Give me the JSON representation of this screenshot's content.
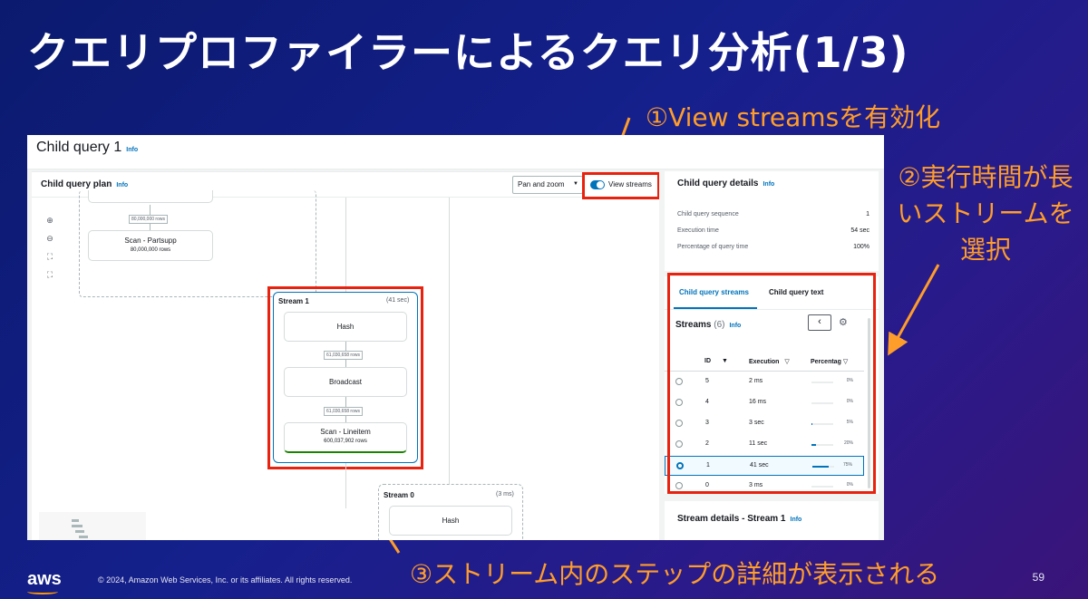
{
  "slide": {
    "title": "クエリプロファイラーによるクエリ分析(1/3)",
    "callout1": "①View streamsを有効化",
    "callout2": "②実行時間が長いストリームを選択",
    "callout3": "③ストリーム内のステップの詳細が表示される",
    "copyright": "© 2024, Amazon Web Services, Inc. or its affiliates. All rights reserved.",
    "page_number": "59",
    "logo": "aws",
    "accent_color": "#ff9d2a"
  },
  "console": {
    "title": "Child query 1",
    "info": "Info",
    "plan": {
      "title": "Child query plan",
      "info": "Info",
      "pan_zoom_label": "Pan and zoom",
      "view_streams_label": "View streams",
      "view_streams_enabled": true,
      "upper_group": {
        "rows_top": "80,000,000 rows",
        "scan_node": "Scan - Partsupp",
        "scan_rows": "80,000,000 rows"
      },
      "stream1": {
        "title": "Stream 1",
        "time": "(41 sec)",
        "node_hash": "Hash",
        "rows_a": "61,030,658 rows",
        "node_broadcast": "Broadcast",
        "rows_b": "61,030,658 rows",
        "node_scan": "Scan - Lineitem",
        "scan_rows": "600,037,902 rows"
      },
      "stream0": {
        "title": "Stream 0",
        "time": "(3 ms)",
        "node_hash": "Hash"
      }
    },
    "details": {
      "title": "Child query details",
      "info": "Info",
      "rows": [
        {
          "label": "Child query sequence",
          "value": "1"
        },
        {
          "label": "Execution time",
          "value": "54 sec"
        },
        {
          "label": "Percentage of query time",
          "value": "100%"
        }
      ]
    },
    "streams_panel": {
      "tab_streams": "Child query streams",
      "tab_text": "Child query text",
      "title": "Streams",
      "count": "(6)",
      "info": "Info",
      "columns": [
        "ID",
        "Execution",
        "Percentag"
      ],
      "rows": [
        {
          "id": "5",
          "execution": "2 ms",
          "percentage": "0%",
          "fraction": 0.0,
          "selected": false
        },
        {
          "id": "4",
          "execution": "16 ms",
          "percentage": "0%",
          "fraction": 0.0,
          "selected": false
        },
        {
          "id": "3",
          "execution": "3 sec",
          "percentage": "5%",
          "fraction": 0.05,
          "selected": false
        },
        {
          "id": "2",
          "execution": "11 sec",
          "percentage": "20%",
          "fraction": 0.2,
          "selected": false
        },
        {
          "id": "1",
          "execution": "41 sec",
          "percentage": "75%",
          "fraction": 0.75,
          "selected": true
        },
        {
          "id": "0",
          "execution": "3 ms",
          "percentage": "0%",
          "fraction": 0.0,
          "selected": false
        }
      ]
    },
    "stream_details": {
      "title": "Stream details - Stream 1",
      "info": "Info"
    }
  }
}
